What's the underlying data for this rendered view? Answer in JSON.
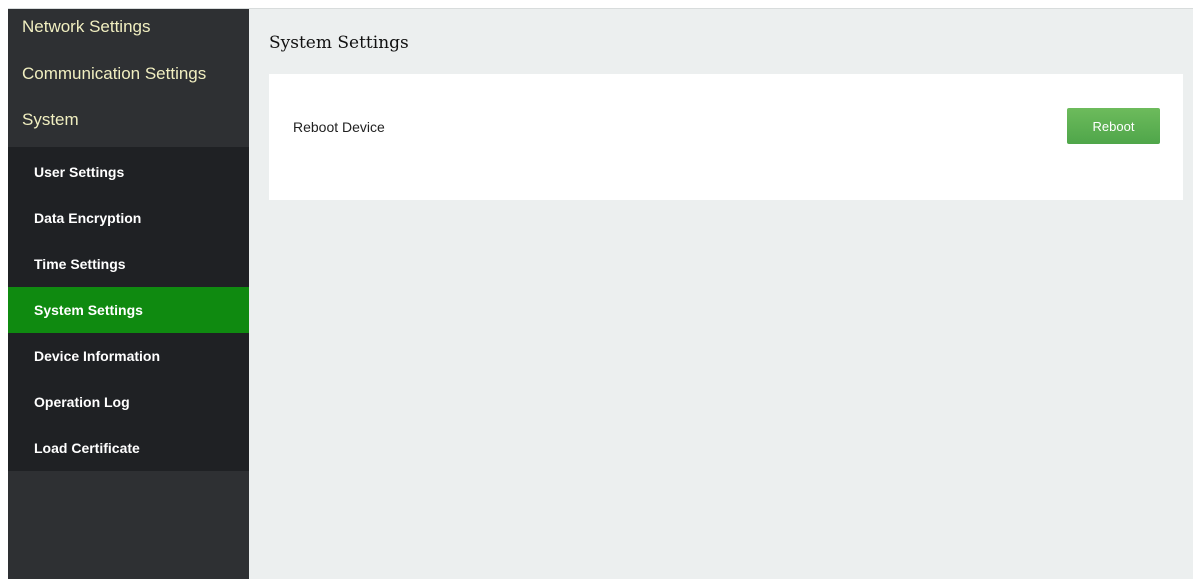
{
  "sidebar": {
    "top_items": [
      {
        "label": "Network Settings"
      },
      {
        "label": "Communication Settings"
      },
      {
        "label": "System"
      }
    ],
    "sub_items": [
      {
        "label": "User Settings",
        "active": false
      },
      {
        "label": "Data Encryption",
        "active": false
      },
      {
        "label": "Time Settings",
        "active": false
      },
      {
        "label": "System Settings",
        "active": true
      },
      {
        "label": "Device Information",
        "active": false
      },
      {
        "label": "Operation Log",
        "active": false
      },
      {
        "label": "Load Certificate",
        "active": false
      }
    ]
  },
  "main": {
    "title": "System Settings",
    "panel": {
      "label": "Reboot Device",
      "button_label": "Reboot"
    }
  },
  "colors": {
    "sidebar_bg": "#2e3033",
    "submenu_bg": "#1f2124",
    "active_item": "#0f8a10",
    "top_item_text": "#f0eec0",
    "button_green": "#5cae50",
    "content_bg": "#ecefef"
  }
}
